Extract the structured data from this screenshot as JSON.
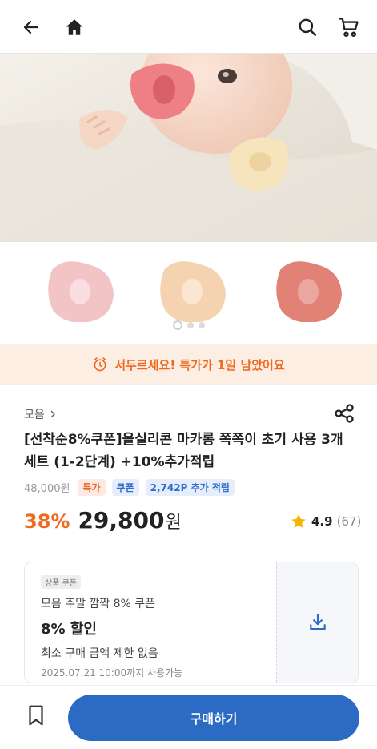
{
  "header": {
    "back_icon": "arrow-left-icon",
    "home_icon": "home-icon",
    "search_icon": "search-icon",
    "cart_icon": "cart-icon"
  },
  "gallery": {
    "colors": [
      "#f2c4c6",
      "#f6d3b0",
      "#e28276"
    ],
    "slide_index": 1,
    "slide_count": 3
  },
  "alert": {
    "icon": "alarm-clock-icon",
    "text": "서두르세요! 특가가 1일 남았어요"
  },
  "product": {
    "breadcrumb": "모음",
    "title": "[선착순8%쿠폰]올실리콘 마카롱 쪽쪽이 초기 사용 3개 세트 (1-2단계) +10%추가적립",
    "original_price": "48,000원",
    "tag_special": "특가",
    "tag_coupon": "쿠폰",
    "tag_points": "2,742P 추가 적립",
    "discount": "38%",
    "price": "29,800",
    "currency": "원",
    "rating": "4.9",
    "review_count": "(67)"
  },
  "coupon": {
    "badge": "상품 쿠폰",
    "name": "모음 주말 깜짝 8% 쿠폰",
    "amount": "8% 할인",
    "condition": "최소 구매 금액 제한 없음",
    "expiry": "2025.07.21 10:00까지 사용가능",
    "download_icon": "download-icon"
  },
  "bottom_bar": {
    "bookmark_icon": "bookmark-icon",
    "buy_label": "구매하기"
  },
  "colors": {
    "accent_orange": "#ef6a1f",
    "accent_blue": "#2c6bc4",
    "alert_bg": "#fdeee4"
  }
}
